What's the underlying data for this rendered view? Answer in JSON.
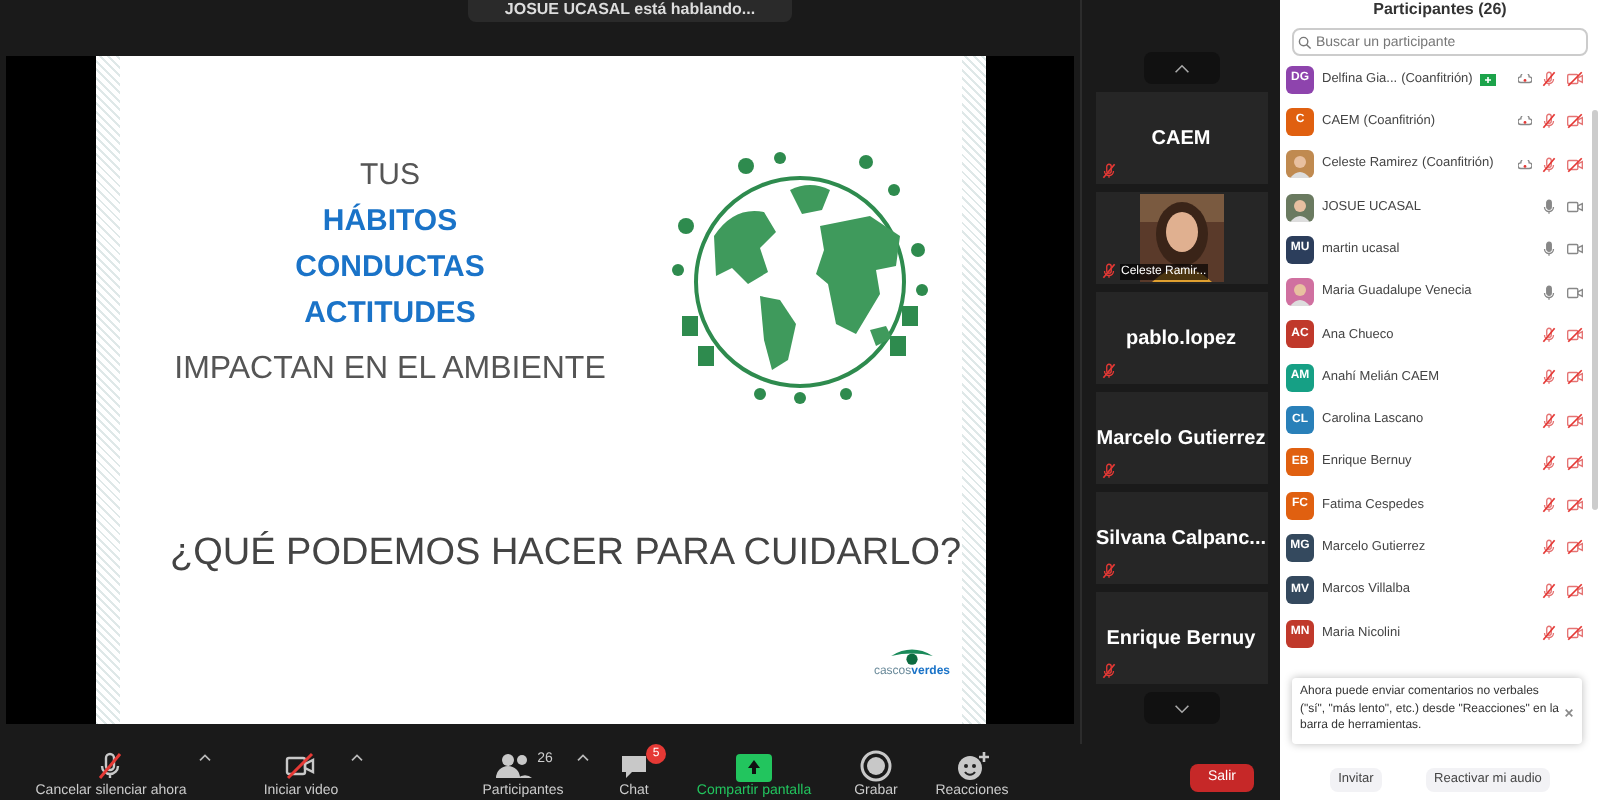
{
  "speaking_toast": {
    "text": "JOSUE UCASAL está hablando..."
  },
  "slide": {
    "lines": [
      {
        "text": "TUS",
        "kind": "plain"
      },
      {
        "text": "HÁBITOS",
        "kind": "accent"
      },
      {
        "text": "CONDUCTAS",
        "kind": "accent"
      },
      {
        "text": "ACTITUDES",
        "kind": "accent"
      },
      {
        "text": "IMPACTAN EN EL AMBIENTE",
        "kind": "plain"
      }
    ],
    "question": "¿QUÉ PODEMOS HACER PARA CUIDARLO?",
    "logo": {
      "part1": "cascos",
      "part2": "verdes"
    }
  },
  "tiles": [
    {
      "name": "CAEM",
      "kind": "text",
      "muted": true
    },
    {
      "name": "Celeste Ramir...",
      "kind": "video",
      "muted": true
    },
    {
      "name": "pablo.lopez",
      "kind": "text",
      "muted": true
    },
    {
      "name": "Marcelo Gutierrez",
      "kind": "text",
      "muted": true
    },
    {
      "name": "Silvana  Calpanc...",
      "kind": "text",
      "muted": true
    },
    {
      "name": "Enrique Bernuy",
      "kind": "text",
      "muted": true
    }
  ],
  "toolbar": [
    {
      "label": "Cancelar silenciar ahora",
      "kind": "mic",
      "crossed": true,
      "caret": true
    },
    {
      "label": "Iniciar video",
      "kind": "video",
      "crossed": true,
      "caret": true
    },
    {
      "label": "Participantes",
      "kind": "people",
      "count": "26",
      "caret": true
    },
    {
      "label": "Chat",
      "kind": "chat",
      "badge": "5"
    },
    {
      "label": "Compartir pantalla",
      "kind": "share",
      "highlight": true
    },
    {
      "label": "Grabar",
      "kind": "record"
    },
    {
      "label": "Reacciones",
      "kind": "react"
    }
  ],
  "leave_button": "Salir",
  "panel": {
    "title": "Participantes (26)",
    "search": {
      "placeholder": "Buscar un participante"
    },
    "participants": [
      {
        "name": "Delfina Gia...",
        "role": "(Coanfitrión)",
        "initials": "DG",
        "color": "#8e44ad",
        "kind": "initials",
        "badge": true,
        "cloud": true,
        "muted": true
      },
      {
        "name": "CAEM",
        "role": "(Coanfitrión)",
        "initials": "C",
        "color": "#e06010",
        "kind": "initials",
        "badge": false,
        "cloud": true,
        "muted": true
      },
      {
        "name": "Celeste Ramirez",
        "role": "(Coanfitrión)",
        "color": "#c08a50",
        "badge": false,
        "cloud": true,
        "muted": true
      },
      {
        "name": "JOSUE UCASAL",
        "color": "#6a7a60",
        "badge": false,
        "cloud": false,
        "muted": false
      },
      {
        "name": "martin ucasal",
        "initials": "MU",
        "color": "#2c3e5c",
        "kind": "initials",
        "badge": false,
        "cloud": false,
        "muted": false
      },
      {
        "name": "Maria Guadalupe Venecia",
        "color": "#d070a0",
        "badge": false,
        "cloud": false,
        "muted": false
      },
      {
        "name": "Ana Chueco",
        "initials": "AC",
        "color": "#c0392b",
        "kind": "initials",
        "badge": false,
        "cloud": false,
        "muted": true
      },
      {
        "name": "Anahí Melián CAEM",
        "initials": "AM",
        "color": "#16a085",
        "kind": "initials",
        "badge": false,
        "cloud": false,
        "muted": true
      },
      {
        "name": "Carolina Lascano",
        "initials": "CL",
        "color": "#2980b9",
        "kind": "initials",
        "badge": false,
        "cloud": false,
        "muted": true
      },
      {
        "name": "Enrique Bernuy",
        "initials": "EB",
        "color": "#e06010",
        "kind": "initials",
        "badge": false,
        "cloud": false,
        "muted": true
      },
      {
        "name": "Fatima Cespedes",
        "initials": "FC",
        "color": "#e06010",
        "kind": "initials",
        "badge": false,
        "cloud": false,
        "muted": true
      },
      {
        "name": "Marcelo Gutierrez",
        "initials": "MG",
        "color": "#34495e",
        "kind": "initials",
        "badge": false,
        "cloud": false,
        "muted": true
      },
      {
        "name": "Marcos Villalba",
        "initials": "MV",
        "color": "#34495e",
        "kind": "initials",
        "badge": false,
        "cloud": false,
        "muted": true
      },
      {
        "name": "Maria Nicolini",
        "initials": "MN",
        "color": "#c0392b",
        "kind": "initials",
        "badge": false,
        "cloud": false,
        "muted": true
      }
    ],
    "tip": {
      "text": "Ahora puede enviar comentarios no verbales (\"sí\", \"más lento\", etc.) desde \"Reacciones\" en la barra de herramientas."
    },
    "buttons": [
      "Invitar",
      "Reactivar mi audio"
    ]
  }
}
